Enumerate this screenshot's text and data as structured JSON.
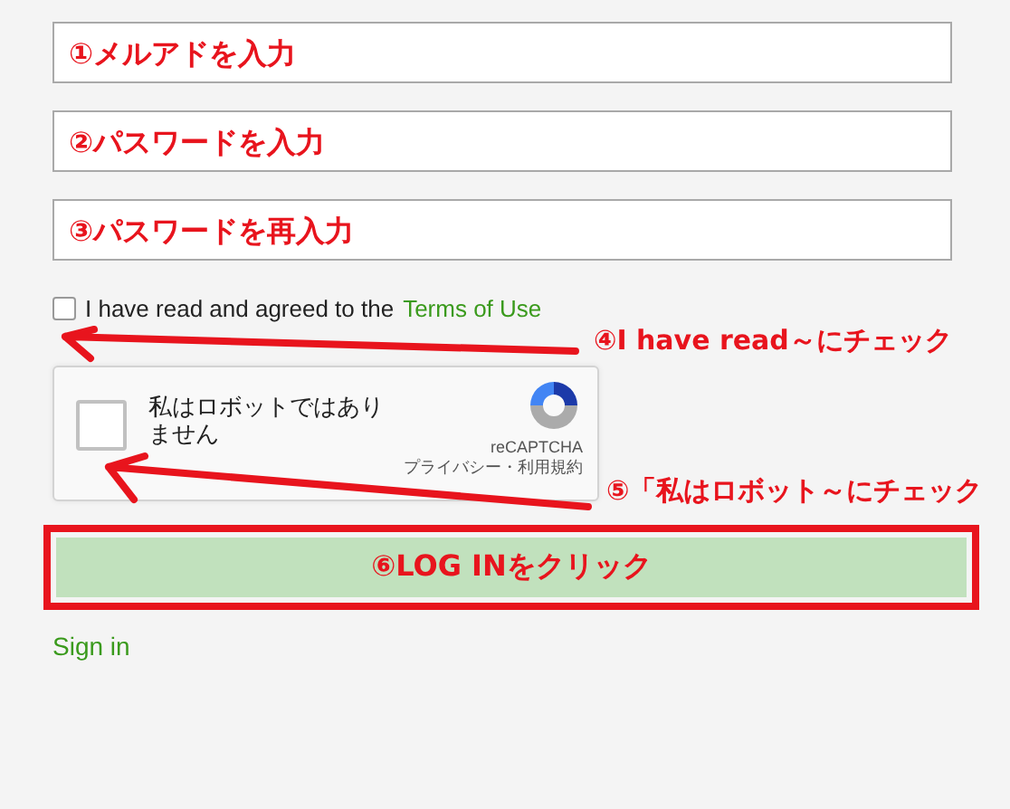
{
  "fields": [
    {
      "placeholder": "①メルアドを入力"
    },
    {
      "placeholder": "②パスワードを入力"
    },
    {
      "placeholder": "③パスワードを再入力"
    }
  ],
  "terms": {
    "checked": false,
    "text": "I have read and agreed to the",
    "link": "Terms of Use"
  },
  "recaptcha": {
    "checked": false,
    "label": "私はロボットではありません",
    "brand": "reCAPTCHA",
    "privacy": "プライバシー・利用規約"
  },
  "login_button": {
    "label": "⑥LOG INをクリック"
  },
  "sign_in_link": "Sign in",
  "annotations": [
    {
      "text": "④I have read～にチェック"
    },
    {
      "text": "⑤「私はロボット～にチェック"
    }
  ]
}
